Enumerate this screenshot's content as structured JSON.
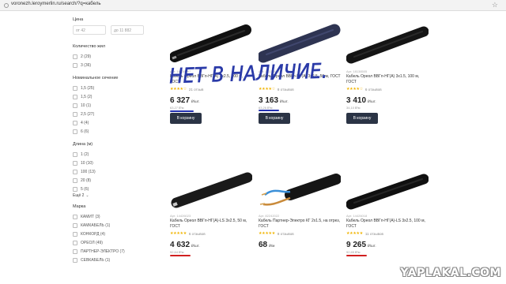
{
  "browser": {
    "url": "voronezh.leroymerlin.ru/search/?q=кабель"
  },
  "sidebar": {
    "price_title": "Цена",
    "price_from": "от 42",
    "price_to": "до 11 882",
    "groups": [
      {
        "title": "Количество жил",
        "items": [
          "2 (29)",
          "3 (36)"
        ]
      },
      {
        "title": "Номинальное сечение",
        "items": [
          "1,5 (25)",
          "1,5 (2)",
          "10 (1)",
          "2,5 (27)",
          "4 (4)",
          "6 (6)"
        ]
      },
      {
        "title": "Длина (м)",
        "items": [
          "1 (2)",
          "10 (10)",
          "100 (13)",
          "20 (8)",
          "5 (6)"
        ],
        "more": "Ещё 2"
      },
      {
        "title": "Марка",
        "items": [
          "КАМИТ (3)",
          "КАМКАБЕЛЬ (1)",
          "КОНКОРД (4)",
          "ОРЕОЛ (49)",
          "ПАРТНЕР-ЭЛЕКТРО (7)",
          "СЕВКАБЕЛЬ (1)"
        ]
      }
    ]
  },
  "products": [
    {
      "article": "Арт. 18138497",
      "name": "Кабель Ореол ВВГп-НГ(А) 3х2.5, 100 м, ГОСТ",
      "stars": "★★★★☆",
      "reviews": "21 отзыв",
      "price": "6 327",
      "unit": "₽/шт.",
      "sub": "63,27 ₽/м",
      "cart": "В корзину"
    },
    {
      "article": "Арт. 18138470",
      "name": "Кабель Ореол ВВГп-НГ(А) 3х2.5, 50 м, ГОСТ",
      "stars": "★★★★☆",
      "reviews": "8 отзывов",
      "price": "3 163",
      "unit": "₽/шт.",
      "sub": "63,26 ₽/м",
      "cart": "В корзину"
    },
    {
      "article": "Арт. 18138505",
      "name": "Кабель Ореол ВВГп-НГ(А) 3х1.5, 100 м, ГОСТ",
      "stars": "★★★★☆",
      "reviews": "6 отзывов",
      "price": "3 410",
      "unit": "₽/шт.",
      "sub": "34,10 ₽/м",
      "cart": "В корзину"
    },
    {
      "article": "Арт. 14426023",
      "name": "Кабель Ореол ВВГп-НГ(А)-LS 3х2.5, 50 м, ГОСТ",
      "stars": "★★★★★",
      "reviews": "6 отзывов",
      "price": "4 632",
      "unit": "₽/шт.",
      "sub": "92,64 ₽/м",
      "cart": "В корзину"
    },
    {
      "article": "Арт. 82242022",
      "name": "Кабель Партнер-Электро КГ 2х1.5, на отрез, ГОСТ",
      "stars": "★★★★★",
      "reviews": "8 отзывов",
      "price": "68",
      "unit": "₽/м",
      "sub": "",
      "cart": ""
    },
    {
      "article": "Арт. 14426018",
      "name": "Кабель Ореол ВВГп-НГ(А)-LS 3х2.5, 100 м, ГОСТ",
      "stars": "★★★★★",
      "reviews": "11 отзывов",
      "price": "9 265",
      "unit": "₽/шт.",
      "sub": "92,65 ₽/м",
      "cart": ""
    }
  ],
  "annotation": {
    "text": "НЕТ В НАЛИЧИЕ.",
    "color": "#2a3aa8"
  },
  "underline_colors": {
    "blue": "#2330b0",
    "red": "#d02020"
  },
  "watermark": "YAPLAKAL.COM"
}
